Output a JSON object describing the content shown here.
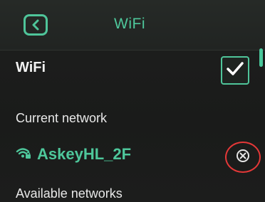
{
  "header": {
    "back_icon": "chevron-left-icon",
    "title": "WiFi"
  },
  "wifi_toggle": {
    "label": "WiFi",
    "checked": true,
    "check_icon": "checkmark-icon"
  },
  "current_network": {
    "section_label": "Current network",
    "name": "AskeyHL_2F",
    "signal_icon": "wifi-lock-icon",
    "disconnect_icon": "circle-x-icon"
  },
  "available_networks": {
    "section_label": "Available networks"
  },
  "colors": {
    "accent": "#4ec79b",
    "highlight": "#e53838",
    "background": "#1b1c1b"
  }
}
